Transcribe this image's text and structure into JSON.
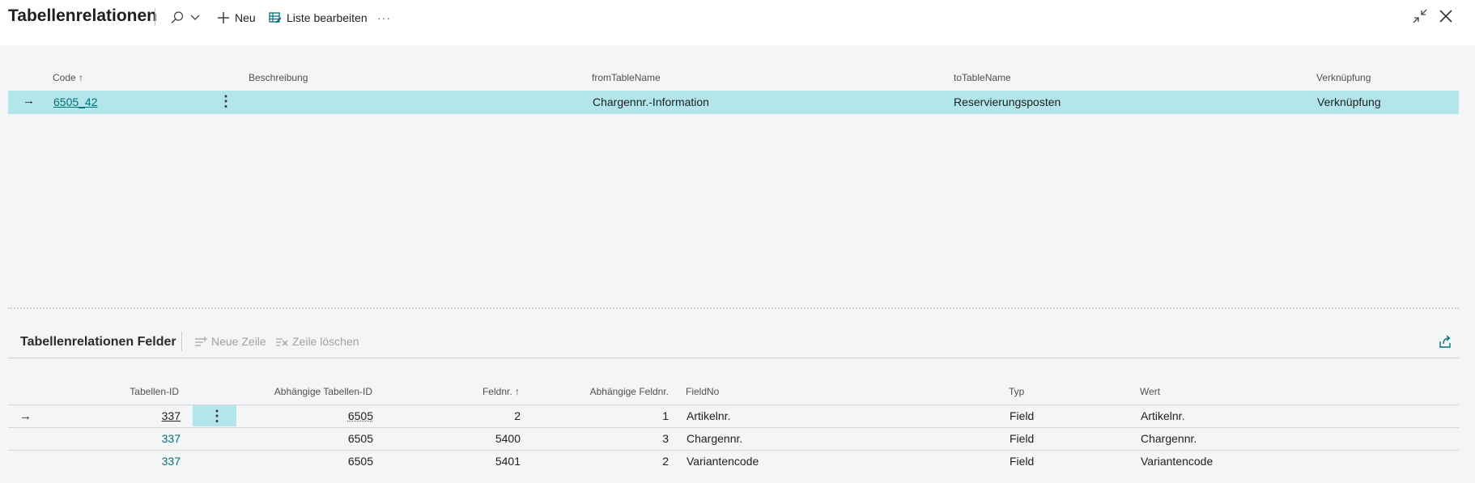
{
  "header": {
    "title": "Tabellenrelationen",
    "new_label": "Neu",
    "edit_list_label": "Liste bearbeiten",
    "more_label": "···"
  },
  "upper_list": {
    "columns": {
      "code": "Code",
      "beschreibung": "Beschreibung",
      "from_table": "fromTableName",
      "to_table": "toTableName",
      "verknuepfung": "Verknüpfung"
    },
    "rows": [
      {
        "code": "6505_42",
        "beschreibung": "",
        "from_table": "Chargennr.-Information",
        "to_table": "Reservierungsposten",
        "verknuepfung": "Verknüpfung"
      }
    ]
  },
  "subpage": {
    "title": "Tabellenrelationen Felder",
    "new_line_label": "Neue Zeile",
    "delete_line_label": "Zeile löschen",
    "columns": {
      "tabellen_id": "Tabellen-ID",
      "abh_tabellen_id": "Abhängige Tabellen-ID",
      "feldnr": "Feldnr.",
      "abh_feldnr": "Abhängige Feldnr.",
      "fieldno": "FieldNo",
      "typ": "Typ",
      "wert": "Wert"
    },
    "rows": [
      {
        "tabellen_id": "337",
        "abh_tabellen_id": "6505",
        "feldnr": "2",
        "abh_feldnr": "1",
        "fieldno": "Artikelnr.",
        "typ": "Field",
        "wert": "Artikelnr."
      },
      {
        "tabellen_id": "337",
        "abh_tabellen_id": "6505",
        "feldnr": "5400",
        "abh_feldnr": "3",
        "fieldno": "Chargennr.",
        "typ": "Field",
        "wert": "Chargennr."
      },
      {
        "tabellen_id": "337",
        "abh_tabellen_id": "6505",
        "feldnr": "5401",
        "abh_feldnr": "2",
        "fieldno": "Variantencode",
        "typ": "Field",
        "wert": "Variantencode"
      }
    ]
  },
  "colors": {
    "accent": "#00707a",
    "selected_row": "#b2e6ea",
    "background": "#f4f5f7"
  }
}
